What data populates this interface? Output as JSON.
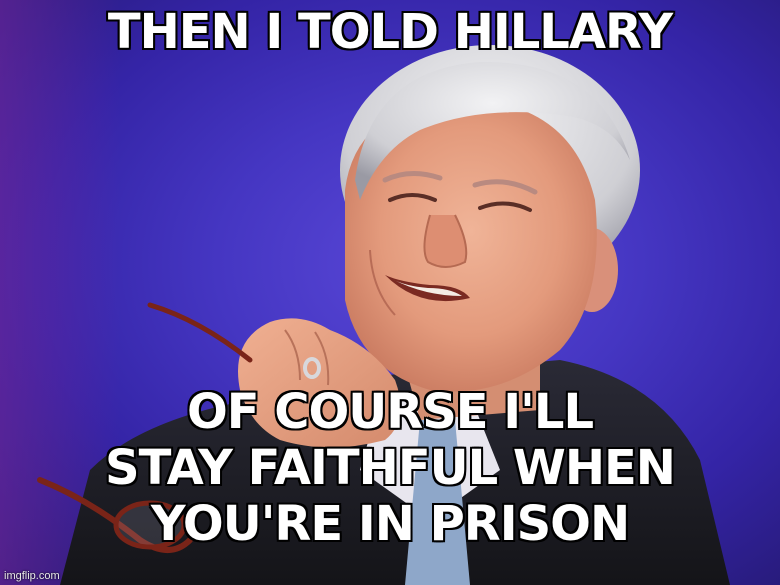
{
  "meme": {
    "top_text": "THEN I TOLD HILLARY",
    "bottom_lines": [
      "OF COURSE I'LL",
      "STAY FAITHFUL WHEN",
      "YOU'RE IN PRISON"
    ],
    "watermark": "imgflip.com"
  },
  "colors": {
    "background": "#4536c2",
    "caption_fill": "#ffffff",
    "caption_stroke": "#000000",
    "suit": "#1c1c26",
    "hair": "#d9d9dc",
    "skin": "#e6a488"
  }
}
